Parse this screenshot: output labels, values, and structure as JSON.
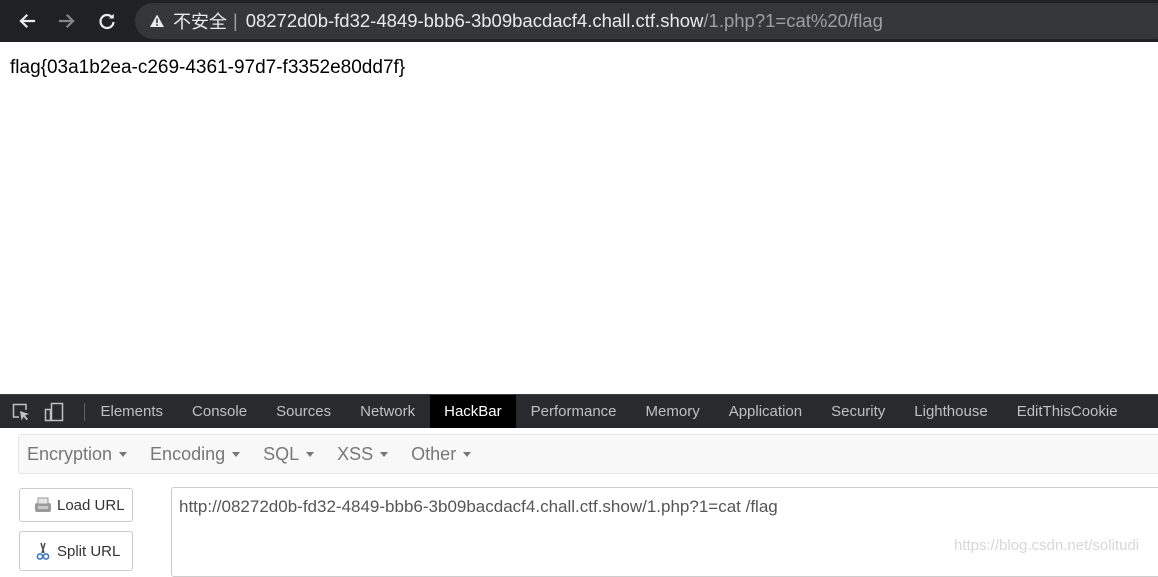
{
  "browser": {
    "security_label": "不安全",
    "separator": "|",
    "url_host": "08272d0b-fd32-4849-bbb6-3b09bacdacf4.chall.ctf.show",
    "url_path": "/1.php?1=cat%20/flag",
    "icons": [
      "back-arrow-icon",
      "forward-arrow-icon",
      "reload-icon",
      "warning-icon"
    ]
  },
  "page": {
    "text": "flag{03a1b2ea-c269-4361-97d7-f3352e80dd7f}"
  },
  "devtools": {
    "tabs": [
      {
        "label": "Elements"
      },
      {
        "label": "Console"
      },
      {
        "label": "Sources"
      },
      {
        "label": "Network"
      },
      {
        "label": "HackBar"
      },
      {
        "label": "Performance"
      },
      {
        "label": "Memory"
      },
      {
        "label": "Application"
      },
      {
        "label": "Security"
      },
      {
        "label": "Lighthouse"
      },
      {
        "label": "EditThisCookie"
      }
    ],
    "active_tab": "HackBar"
  },
  "hackbar": {
    "menu": [
      {
        "label": "Encryption"
      },
      {
        "label": "Encoding"
      },
      {
        "label": "SQL"
      },
      {
        "label": "XSS"
      },
      {
        "label": "Other"
      }
    ],
    "load_url_label": "Load URL",
    "split_url_label": "Split URL",
    "url_value": "http://08272d0b-fd32-4849-bbb6-3b09bacdacf4.chall.ctf.show/1.php?1=cat /flag"
  },
  "watermark": "https://blog.csdn.net/solitudi",
  "colors": {
    "chrome_bg": "#202124",
    "omnibox_bg": "#35363a",
    "devtools_bg": "#292a2d",
    "active_tab_bg": "#000000"
  }
}
